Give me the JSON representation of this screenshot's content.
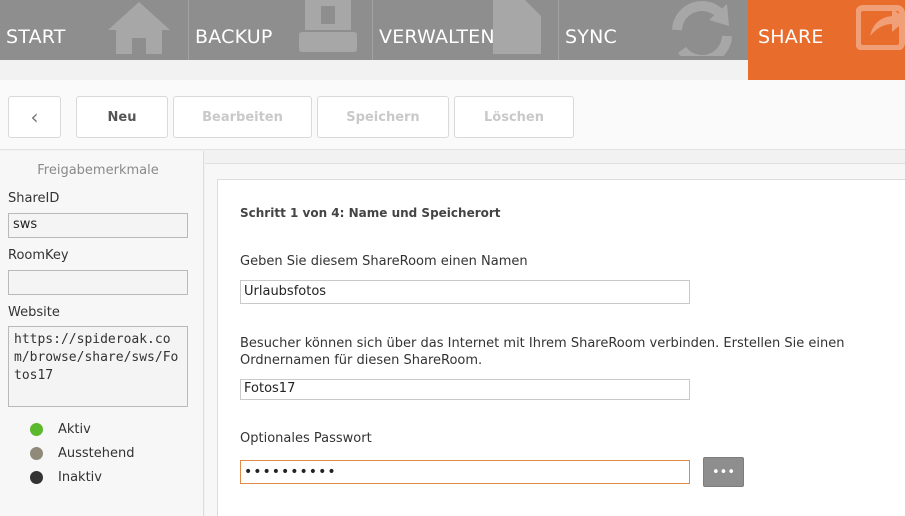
{
  "nav": {
    "tabs": [
      {
        "label": "START",
        "icon": "home-icon"
      },
      {
        "label": "BACKUP",
        "icon": "backup-drive-icon"
      },
      {
        "label": "VERWALTEN",
        "icon": "document-icon"
      },
      {
        "label": "SYNC",
        "icon": "sync-arrows-icon"
      },
      {
        "label": "SHARE",
        "icon": "share-arrow-icon",
        "active": true
      }
    ],
    "active_color": "#e86c2c",
    "bar_color": "#8e8e8e"
  },
  "toolbar": {
    "back_glyph": "‹",
    "new_label": "Neu",
    "edit_label": "Bearbeiten",
    "save_label": "Speichern",
    "delete_label": "Löschen"
  },
  "sidebar": {
    "title": "Freigabemerkmale",
    "shareid_label": "ShareID",
    "shareid_value": "sws",
    "roomkey_label": "RoomKey",
    "roomkey_value": "",
    "website_label": "Website",
    "website_value": "https://spideroak.com/browse/share/sws/Fotos17",
    "legend": [
      {
        "label": "Aktiv",
        "color": "#5cb82c"
      },
      {
        "label": "Ausstehend",
        "color": "#8f8a7a"
      },
      {
        "label": "Inaktiv",
        "color": "#333333"
      }
    ]
  },
  "form": {
    "step_title": "Schritt 1 von 4: Name und Speicherort",
    "name_label": "Geben Sie diesem ShareRoom einen Namen",
    "name_value": "Urlaubsfotos",
    "folder_label_line1": "Besucher können sich über das Internet mit Ihrem ShareRoom verbinden. Erstellen Sie einen",
    "folder_label_line2": "Ordnernamen für diesen ShareRoom.",
    "folder_value": "Fotos17",
    "password_label": "Optionales Passwort",
    "password_value": "••••••••••",
    "reveal_label": "•••"
  }
}
